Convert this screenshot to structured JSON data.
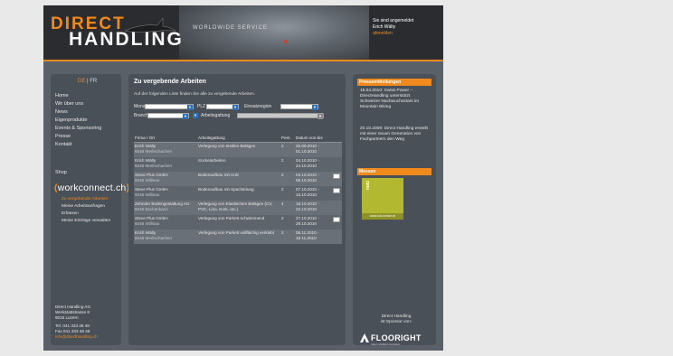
{
  "header": {
    "logo_direct": "DIRECT",
    "logo_handling": "HANDLING",
    "slogan": "WORLDWIDE SERVICE",
    "login_status": "Sie sind angemeldet",
    "user": "Erich Wälty",
    "logout": "abmelden"
  },
  "lang": {
    "de": "DE",
    "sep": "|",
    "fr": "FR"
  },
  "nav": [
    "Home",
    "Wir über uns",
    "News",
    "Eigenprodukte",
    "Events & Sponsoring",
    "Presse",
    "Kontakt"
  ],
  "shop": "Shop",
  "workconnect": {
    "open": "(",
    "name": "workconnect.ch",
    "close": ")"
  },
  "wc_nav": [
    "Zu vergebende Arbeiten",
    "Meine Arbeitsanfragen",
    "Erfassen",
    "Meine Einträge verwalten"
  ],
  "address": {
    "line1": "Direct Handling AG",
    "line2": "Werkstattstrasse 8",
    "line3": "6015 Luzern",
    "tel": "Tel. 041 333 48 48",
    "fax": "Fax 041 333 48 49",
    "email": "info@directhandling.ch"
  },
  "main": {
    "title": "Zu vergebende Arbeiten",
    "intro": "Auf der folgenden Liste finden Sie alle zu vergebende Arbeiten.",
    "filters": {
      "monat_label": "Monat",
      "plz_label": "PLZ",
      "einsatzregion_label": "Einsatzregion",
      "branche_label": "Branche",
      "arbeitsgattung_label": "Arbeitsgattung",
      "select_value": "-"
    },
    "columns": [
      "Firma / Ort",
      "Arbeitsgattung",
      "Pers.",
      "Datum von-bis"
    ],
    "rows": [
      {
        "firma": "Erich Wälty",
        "ort": "6048 Merlischachen",
        "arbeit": "Verlegung von textilen Belägen",
        "pers": "2",
        "von": "25.09.2010 -",
        "bis": "01.10.2010",
        "mail": false
      },
      {
        "firma": "Erich Wälty",
        "ort": "6048 Merlischachen",
        "arbeit": "Sockelarbeiten",
        "pers": "2",
        "von": "04.10.2010 -",
        "bis": "24.10.2010",
        "mail": false
      },
      {
        "firma": "Steve Plus GmbH",
        "ort": "6048 Willisau",
        "arbeit": "Bodenaufbau mit Holz",
        "pers": "2",
        "von": "04.10.2010 -",
        "bis": "06.10.2010",
        "mail": true
      },
      {
        "firma": "Steve Plus GmbH",
        "ort": "6048 Willisau",
        "arbeit": "Bodenaufbau mit Spachtelung",
        "pers": "2",
        "von": "07.10.2010 -",
        "bis": "16.10.2010",
        "mail": true
      },
      {
        "firma": "Zehnder Bodengestaltung AG",
        "ort": "6048 Eschenbach",
        "arbeit": "Verlegung von Elastischen Belägen (CV, PVC, Lino, Kork, etc.)",
        "pers": "4",
        "von": "18.10.2010 -",
        "bis": "22.10.2010",
        "mail": false
      },
      {
        "firma": "Steve Plus GmbH",
        "ort": "6048 Willisau",
        "arbeit": "Verlegung von Parkett schwimmend",
        "pers": "2",
        "von": "27.10.2010 -",
        "bis": "29.10.2010",
        "mail": true
      },
      {
        "firma": "Erich Wälty",
        "ort": "6048 Merlischachen",
        "arbeit": "Verlegung von Parkett vollflächig verklebt",
        "pers": "2",
        "von": "08.11.2010 -",
        "bis": "19.11.2010",
        "mail": false
      }
    ]
  },
  "right": {
    "press_title": "Pressemitteilungen",
    "news1": "15.04.2010: Swiss Power – DirectHandling unterstützt Schweizer Nachwuchsstars im Mountain Biking",
    "news2": "20.10.2009: Direct Handling erstellt mit einer neuen Generation von Fachpartnern den Weg",
    "messen_title": "Messen",
    "messen_img_text": "nutz",
    "messen_img_caption": "www.nutz-messe.ch",
    "sponsor_line1": "Direct Handling",
    "sponsor_line2": "ist Sponsor von:",
    "floor_name": "FLOORIGHT",
    "floor_tag": "Ideen·Vielfalt·Innovation"
  },
  "colors": {
    "accent": "#f08a1c",
    "panel": "#4a5057",
    "frame": "#5a6067",
    "bg": "#e9e9e9",
    "select_btn": "#2e6fb3",
    "messen": "#b3b831"
  }
}
